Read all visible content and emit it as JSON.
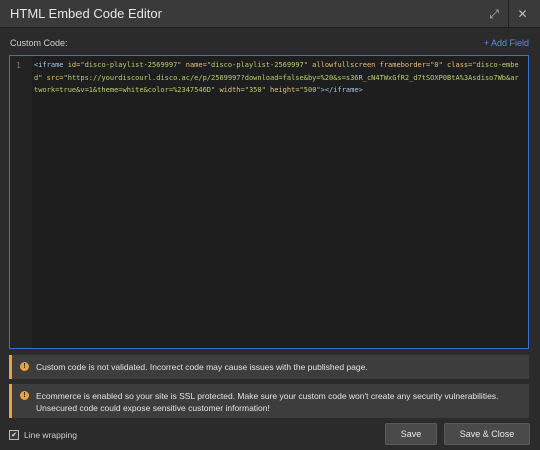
{
  "window": {
    "title": "HTML Embed Code Editor",
    "expand_icon": "expand-icon",
    "close_icon": "close-icon"
  },
  "editor": {
    "label": "Custom Code:",
    "add_field": "+ Add Field",
    "line_number": "1",
    "code_segments": [
      {
        "cls": "tag",
        "text": "<iframe "
      },
      {
        "cls": "attr",
        "text": "id="
      },
      {
        "cls": "str",
        "text": "\"disco-playlist-2569997\" "
      },
      {
        "cls": "attr",
        "text": "name="
      },
      {
        "cls": "str",
        "text": "\"disco-playlist-2569997\" "
      },
      {
        "cls": "attr",
        "text": "allowfullscreen frameborder="
      },
      {
        "cls": "str",
        "text": "\"0\" "
      },
      {
        "cls": "attr",
        "text": "class="
      },
      {
        "cls": "str",
        "text": "\"disco-embed\" "
      },
      {
        "cls": "attr",
        "text": "src="
      },
      {
        "cls": "str",
        "text": "\"https://yourdiscourl.disco.ac/e/p/2569997?download=false&by=%20&s=s36R_cN4TWxGfR2_d7tSOXP0BtA%3Asdiso7Wb&artwork=true&v=1&theme=white&color=%2347546D\" "
      },
      {
        "cls": "attr",
        "text": "width="
      },
      {
        "cls": "str",
        "text": "\"350\" "
      },
      {
        "cls": "attr",
        "text": "height="
      },
      {
        "cls": "str",
        "text": "\"500\""
      },
      {
        "cls": "tag",
        "text": "></iframe>"
      }
    ]
  },
  "notices": [
    {
      "text": "Custom code is not validated. Incorrect code may cause issues with the published page."
    },
    {
      "text": "Ecommerce is enabled so your site is SSL protected. Make sure your custom code won't create any security vulnerabilities. Unsecured code could expose sensitive customer information!"
    }
  ],
  "footer": {
    "line_wrapping_label": "Line wrapping",
    "line_wrapping_checked": true,
    "save_label": "Save",
    "save_close_label": "Save & Close"
  },
  "colors": {
    "accent": "#3c6fd6",
    "warning": "#e8a33d",
    "link": "#5a8dee"
  }
}
